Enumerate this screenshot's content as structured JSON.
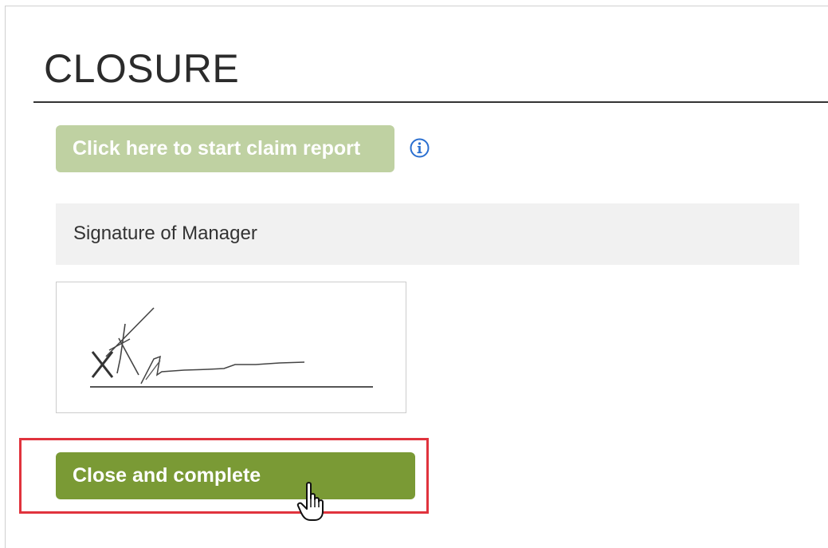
{
  "section": {
    "title": "CLOSURE"
  },
  "claim_report": {
    "button_label": "Click here to start claim report",
    "info_icon": "info-icon"
  },
  "signature": {
    "label": "Signature of Manager"
  },
  "actions": {
    "close_label": "Close and complete"
  },
  "colors": {
    "claim_button_disabled": "#bfd1a2",
    "close_button": "#7a9a35",
    "highlight": "#e0333d",
    "info_icon": "#2a6fd0"
  },
  "cursor": "hand-pointer-icon"
}
